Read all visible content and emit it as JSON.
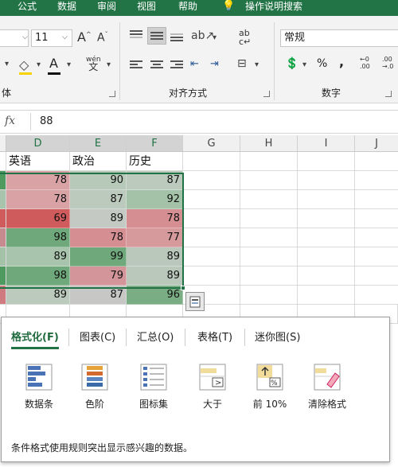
{
  "ribbon_tabs": [
    "公式",
    "数据",
    "审阅",
    "视图",
    "帮助",
    "操作说明搜索"
  ],
  "font": {
    "size": "11"
  },
  "number_format": {
    "value": "常规",
    "percent": "%",
    "comma": ","
  },
  "groups": {
    "font": "体",
    "alignment": "对齐方式",
    "number": "数字"
  },
  "formula_bar": {
    "fx": "fx",
    "value": "88"
  },
  "columns": [
    "D",
    "E",
    "F",
    "G",
    "H",
    "I",
    "J"
  ],
  "headers": {
    "D": "英语",
    "E": "政治",
    "F": "历史"
  },
  "rows": [
    {
      "D": "78",
      "E": "90",
      "F": "87"
    },
    {
      "D": "78",
      "E": "87",
      "F": "92"
    },
    {
      "D": "69",
      "E": "89",
      "F": "78"
    },
    {
      "D": "98",
      "E": "78",
      "F": "77"
    },
    {
      "D": "89",
      "E": "99",
      "F": "89"
    },
    {
      "D": "98",
      "E": "79",
      "F": "89"
    },
    {
      "D": "89",
      "E": "87",
      "F": "96"
    }
  ],
  "cell_colors": [
    [
      "#d9a3a6",
      "#b7c9b9",
      "#bccabd"
    ],
    [
      "#d9a3a6",
      "#bccabd",
      "#a4c2a8"
    ],
    [
      "#cf5b5d",
      "#c5c9c4",
      "#d58e92"
    ],
    [
      "#6fa87a",
      "#d58e92",
      "#d6999c"
    ],
    [
      "#a9c4ad",
      "#6fa87a",
      "#b9c8bb"
    ],
    [
      "#6fa87a",
      "#d39599",
      "#b9c8bb"
    ],
    [
      "#bccabd",
      "#c7c7c6",
      "#7aad83"
    ]
  ],
  "left_edge_colors": [
    "#4f9a5e",
    "#a8c4ac",
    "#cf5b5d",
    "#c58b8f",
    "#a4c2a8",
    "#4f9a5e",
    "#cf7b80"
  ],
  "quick_analysis": {
    "tabs": [
      "格式化(F)",
      "图表(C)",
      "汇总(O)",
      "表格(T)",
      "迷你图(S)"
    ],
    "active_tab": "格式化(F)",
    "options": [
      {
        "label": "数据条",
        "icon": "data-bars-icon"
      },
      {
        "label": "色阶",
        "icon": "color-scale-icon"
      },
      {
        "label": "图标集",
        "icon": "icon-set-icon"
      },
      {
        "label": "大于",
        "icon": "greater-than-icon"
      },
      {
        "label": "前 10%",
        "icon": "top-10-icon"
      },
      {
        "label": "清除格式",
        "icon": "clear-format-icon"
      }
    ],
    "description": "条件格式使用规则突出显示感兴趣的数据。"
  },
  "colors": {
    "accent": "#227346",
    "selection_border": "#217346"
  }
}
